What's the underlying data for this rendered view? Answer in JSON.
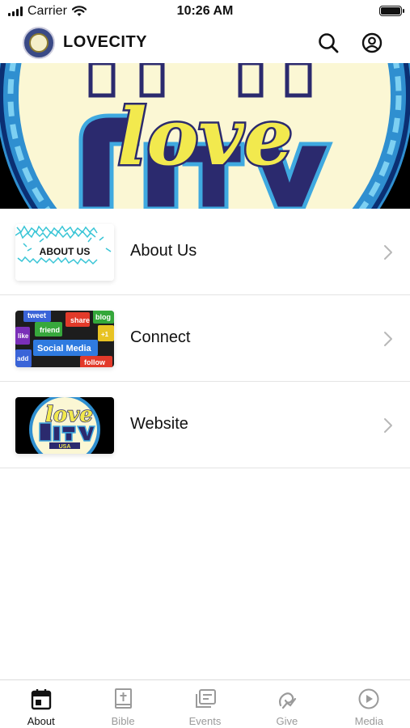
{
  "status_bar": {
    "carrier": "Carrier",
    "time": "10:26 AM"
  },
  "header": {
    "title": "LOVECITY",
    "icons": [
      "search-icon",
      "account-icon"
    ]
  },
  "banner": {
    "text_love": "love",
    "text_city": "CITY"
  },
  "menu": {
    "items": [
      {
        "label": "About Us",
        "thumb_text": "ABOUT US"
      },
      {
        "label": "Connect",
        "thumb_words": [
          "tweet",
          "blog",
          "like",
          "friend",
          "share",
          "+1",
          "Social Media",
          "add",
          "follow"
        ]
      },
      {
        "label": "Website",
        "thumb_love": "love",
        "thumb_city": "CITY",
        "thumb_usa": "USA"
      }
    ]
  },
  "tabs": [
    {
      "label": "About",
      "icon": "calendar-icon",
      "active": true
    },
    {
      "label": "Bible",
      "icon": "bible-icon",
      "active": false
    },
    {
      "label": "Events",
      "icon": "events-icon",
      "active": false
    },
    {
      "label": "Give",
      "icon": "give-icon",
      "active": false
    },
    {
      "label": "Media",
      "icon": "play-icon",
      "active": false
    }
  ],
  "colors": {
    "accent_yellow": "#f2e94e",
    "navy": "#2b2a6e",
    "sky_blue": "#3fa9e0",
    "cream": "#fbf7d4"
  }
}
